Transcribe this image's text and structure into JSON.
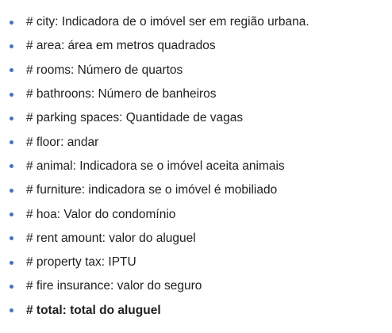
{
  "bullet_color": "#4472c4",
  "items": [
    {
      "text": "# city: Indicadora de o imóvel ser em região urbana.",
      "bold": false
    },
    {
      "text": "# area: área em metros quadrados",
      "bold": false
    },
    {
      "text": "# rooms: Número de quartos",
      "bold": false
    },
    {
      "text": "# bathroons: Número de banheiros",
      "bold": false
    },
    {
      "text": "# parking spaces: Quantidade de vagas",
      "bold": false
    },
    {
      "text": "# floor: andar",
      "bold": false
    },
    {
      "text": "# animal: Indicadora se o imóvel aceita animais",
      "bold": false
    },
    {
      "text": "# furniture: indicadora se o imóvel é mobiliado",
      "bold": false
    },
    {
      "text": "# hoa: Valor do condomínio",
      "bold": false
    },
    {
      "text": "# rent amount: valor do aluguel",
      "bold": false
    },
    {
      "text": "# property tax: IPTU",
      "bold": false
    },
    {
      "text": "# fire insurance: valor do seguro",
      "bold": false
    },
    {
      "text": "# total: total do aluguel",
      "bold": true
    }
  ]
}
